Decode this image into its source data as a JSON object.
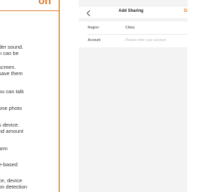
{
  "document": {
    "title": "on",
    "lines": [
      "der sound.",
      "n can be",
      "",
      "screen.",
      "save them",
      "",
      "ou can talk",
      "",
      "one photo",
      "",
      "s device.",
      "nd amount",
      "",
      "arm",
      "",
      "e-based",
      "",
      "ce, device",
      "on detection"
    ]
  },
  "app": {
    "nav": {
      "back_icon": "chevron-left-icon",
      "title": "Add Sharing",
      "done_label": "Do"
    },
    "form": {
      "region_label": "Region",
      "region_value": "China",
      "account_label": "Account",
      "account_placeholder": "Please enter your account"
    },
    "colors": {
      "accent": "#e0772a",
      "background": "#f3f3f3"
    }
  }
}
